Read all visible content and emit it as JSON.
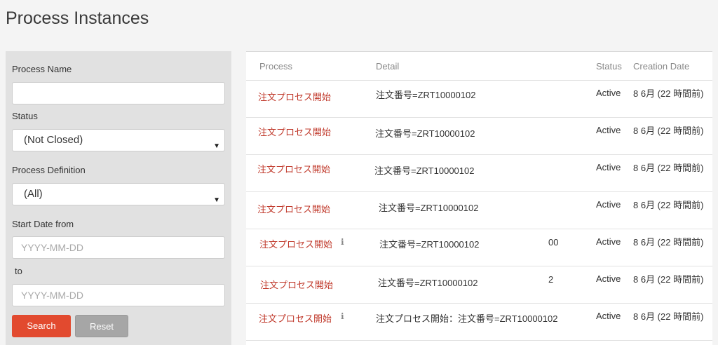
{
  "page": {
    "title": "Process Instances"
  },
  "filters": {
    "process_name_label": "Process Name",
    "process_name_value": "",
    "status_label": "Status",
    "status_value": "(Not Closed)",
    "definition_label": "Process Definition",
    "definition_value": "(All)",
    "start_from_label": "Start Date from",
    "start_from_placeholder": "YYYY-MM-DD",
    "to_label": "to",
    "to_placeholder": "YYYY-MM-DD",
    "search_label": "Search",
    "reset_label": "Reset"
  },
  "table": {
    "columns": [
      "Process",
      "Detail",
      "Status",
      "Creation Date"
    ],
    "rows": [
      {
        "process": "注文プロセス開始",
        "info": "",
        "detail": "注文番号=ZRT10000102",
        "frag": "",
        "status": "Active",
        "date": "8 6月 (22 時間前)"
      },
      {
        "process": "注文プロセス開始",
        "info": "",
        "detail": "注文番号=ZRT10000102",
        "frag": "",
        "status": "Active",
        "date": "8 6月 (22 時間前)"
      },
      {
        "process": "注文プロセス開始",
        "info": "",
        "detail": "注文番号=ZRT10000102",
        "frag": "",
        "status": "Active",
        "date": "8 6月 (22 時間前)"
      },
      {
        "process": "注文プロセス開始",
        "info": "",
        "detail": "注文番号=ZRT10000102",
        "frag": "",
        "status": "Active",
        "date": "8 6月 (22 時間前)"
      },
      {
        "process": "注文プロセス開始",
        "info": "ℹ",
        "detail": "注文番号=ZRT10000102",
        "frag": "00",
        "status": "Active",
        "date": "8 6月 (22 時間前)"
      },
      {
        "process": "注文プロセス開始",
        "info": "",
        "detail": "注文番号=ZRT10000102",
        "frag": "2",
        "status": "Active",
        "date": "8 6月 (22 時間前)"
      },
      {
        "process": "注文プロセス開始",
        "info": "ℹ",
        "detail": "注文プロセス開始：注文番号=ZRT10000102",
        "frag": "",
        "status": "Active",
        "date": "8 6月 (22 時間前)"
      }
    ]
  }
}
